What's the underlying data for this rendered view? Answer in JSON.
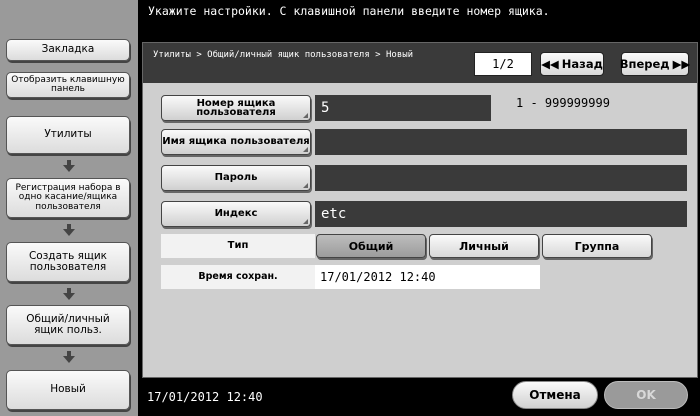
{
  "instruction": "Укажите настройки. С клавишной панели введите номер ящика.",
  "sidebar": {
    "bookmark": "Закладка",
    "show_keypad": "Отобразить клавишную панель",
    "steps": [
      "Утилиты",
      "Регистрация набора в одно касание/ящика пользователя",
      "Создать ящик пользователя",
      "Общий/личный ящик польз.",
      "Новый"
    ]
  },
  "header": {
    "breadcrumb": "Утилиты > Общий/личный ящик пользователя > Новый",
    "page_indicator": "1/2",
    "back_label": "Назад",
    "forward_label": "Вперед"
  },
  "form": {
    "box_number": {
      "label": "Номер ящика пользователя",
      "value": "5",
      "range": "1 - 999999999"
    },
    "box_name": {
      "label": "Имя ящика пользователя",
      "value": ""
    },
    "password": {
      "label": "Пароль",
      "value": ""
    },
    "index": {
      "label": "Индекс",
      "value": "etc"
    },
    "type": {
      "label": "Тип",
      "options": [
        "Общий",
        "Личный",
        "Группа"
      ],
      "selected": "Общий"
    },
    "storage_time": {
      "label": "Время сохран.",
      "value": "17/01/2012   12:40"
    }
  },
  "footer": {
    "datetime": "17/01/2012   12:40",
    "cancel_label": "Отмена",
    "ok_label": "OK"
  },
  "colors": {
    "header_bg": "#3a3a3a",
    "panel_bg": "#cfcfcf",
    "sidebar_bg": "#9a9a9a",
    "selected_option": "#a8a8a8"
  }
}
